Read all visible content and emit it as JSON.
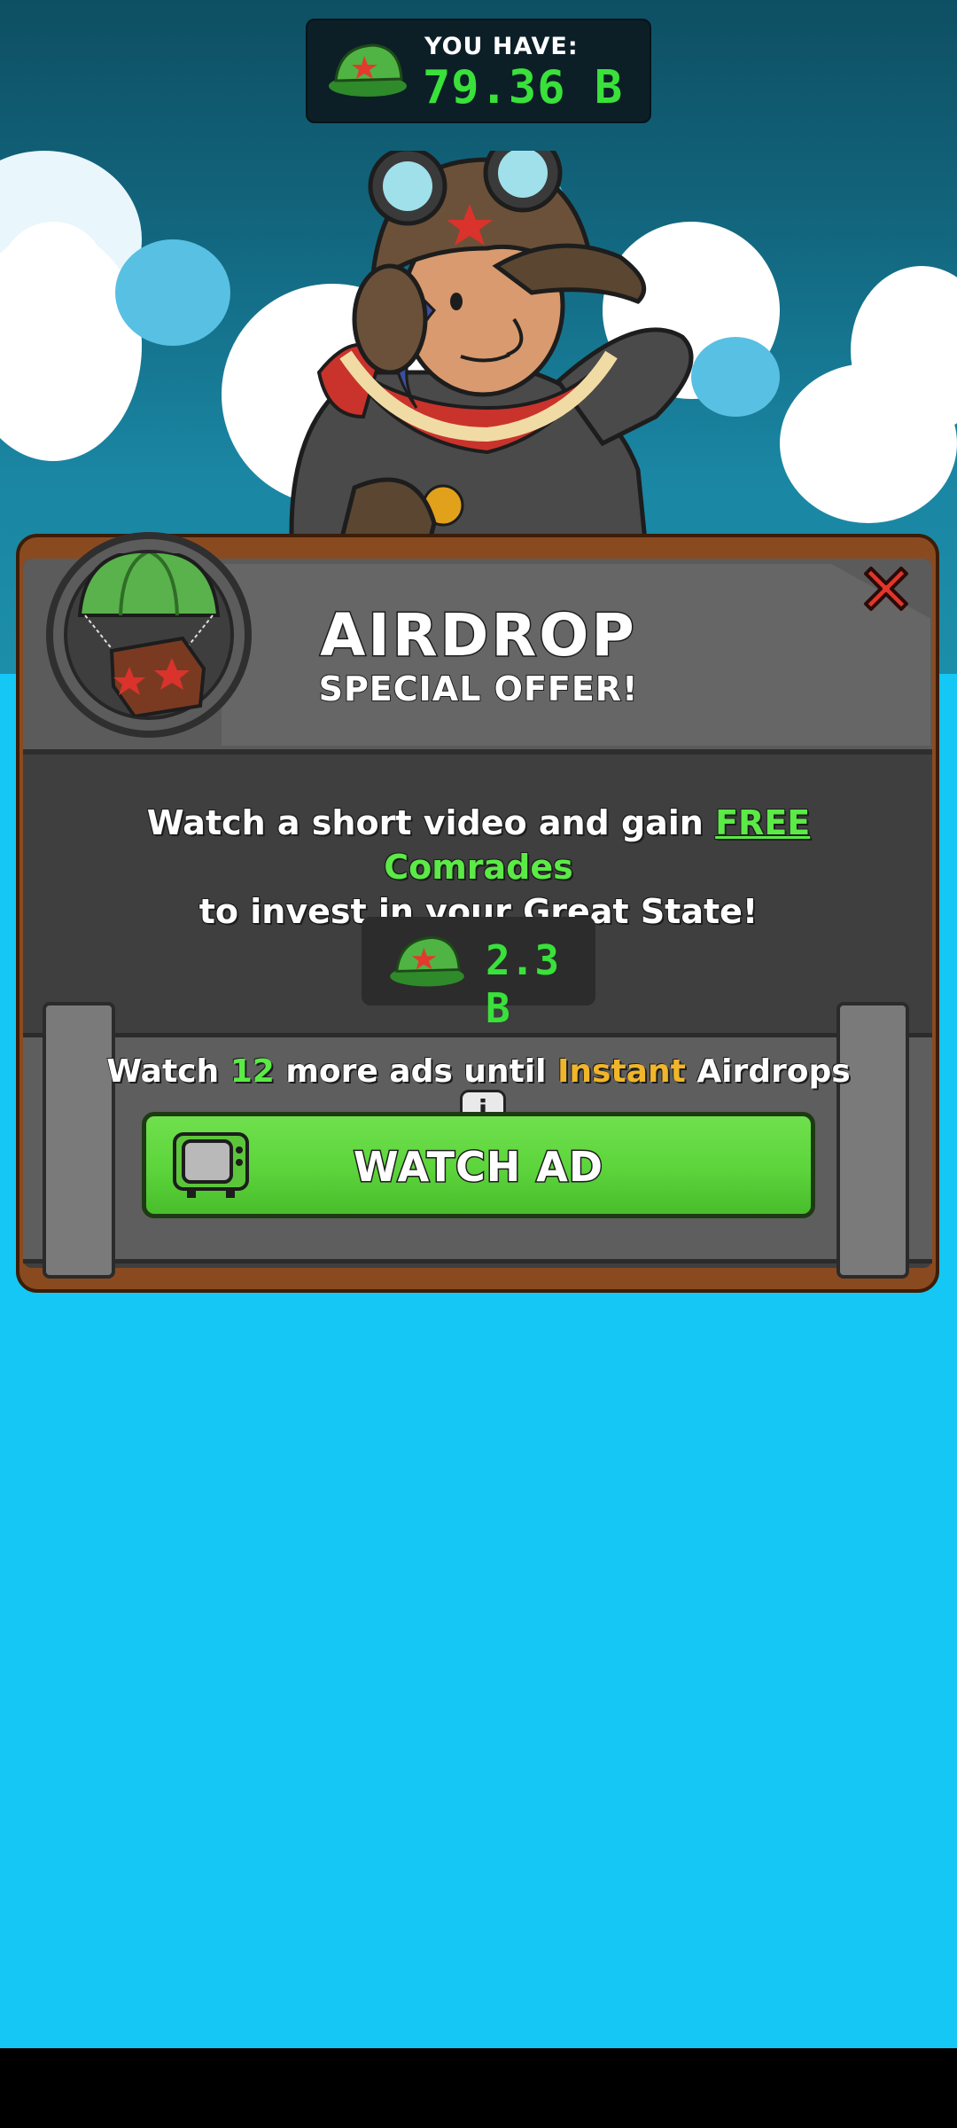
{
  "wallet": {
    "label": "YOU HAVE:",
    "value": "79.36 B"
  },
  "offer": {
    "title": "AIRDROP",
    "subtitle": "SPECIAL OFFER!",
    "desc_part1": "Watch a short video and gain ",
    "desc_free": "FREE",
    "desc_comrades": " Comrades",
    "desc_part2": "to invest in your Great State!",
    "reward_amount": "2.3 B"
  },
  "ads": {
    "prefix": "Watch ",
    "count": "12",
    "middle": " more ads until ",
    "instant": "Instant",
    "suffix": " Airdrops",
    "info_symbol": "i",
    "button_label": "WATCH AD"
  },
  "colors": {
    "accent_green": "#39e13a",
    "button_green": "#5cd43b",
    "instant_orange": "#f0b52a",
    "close_red": "#d9332b"
  },
  "icons": [
    "cap-icon",
    "parachute-crate-icon",
    "close-icon",
    "info-icon",
    "tv-icon",
    "pilot-character"
  ]
}
